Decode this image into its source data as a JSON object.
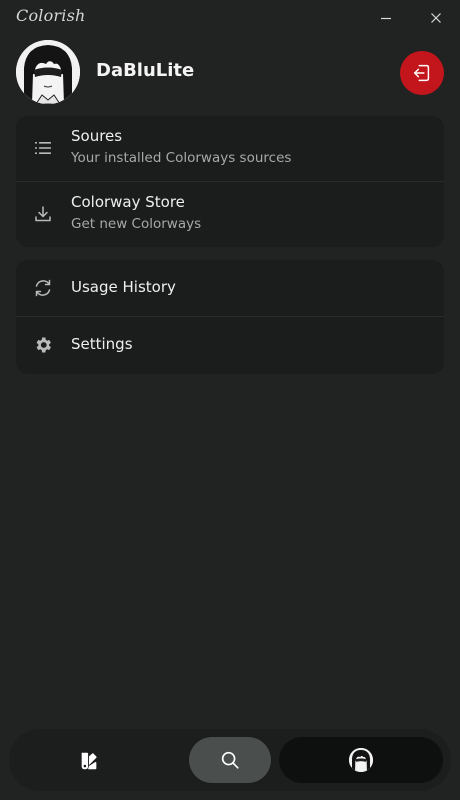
{
  "app": {
    "title": "Colorish"
  },
  "titlebar": {
    "minimize_icon": "minimize-icon",
    "close_icon": "close-icon"
  },
  "profile": {
    "username": "DaBluLite",
    "avatar_icon": "avatar",
    "logout_icon": "logout-icon",
    "logout_color": "#c3161c"
  },
  "menu": {
    "group1": [
      {
        "label": "Soures",
        "sublabel": "Your installed Colorways sources",
        "icon": "list-icon"
      },
      {
        "label": "Colorway Store",
        "sublabel": "Get new Colorways",
        "icon": "download-icon"
      }
    ],
    "group2": [
      {
        "label": "Usage History",
        "icon": "history-icon"
      },
      {
        "label": "Settings",
        "icon": "gear-icon"
      }
    ]
  },
  "bottom_nav": {
    "items": [
      {
        "icon": "palette-icon"
      },
      {
        "icon": "search-icon",
        "active": true
      },
      {
        "icon": "profile-avatar"
      }
    ]
  },
  "colors": {
    "background": "#212222",
    "card": "#1b1c1c",
    "accent_red": "#c3161c",
    "text_primary": "#efefef",
    "text_secondary": "#a7a9a9"
  }
}
